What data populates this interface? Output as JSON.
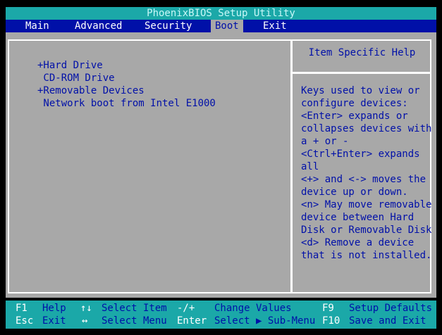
{
  "window": {
    "title": "PhoenixBIOS Setup Utility"
  },
  "menu": {
    "items": [
      {
        "label": "Main"
      },
      {
        "label": "Advanced"
      },
      {
        "label": "Security"
      },
      {
        "label": "Boot"
      },
      {
        "label": "Exit"
      }
    ],
    "active": "Boot"
  },
  "boot_order": {
    "items": [
      {
        "label": "+Hard Drive"
      },
      {
        "label": " CD-ROM Drive"
      },
      {
        "label": "+Removable Devices"
      },
      {
        "label": " Network boot from Intel E1000"
      }
    ]
  },
  "help": {
    "title": "Item Specific Help",
    "lines": [
      "Keys used to view or",
      "configure devices:",
      "<Enter> expands or",
      "collapses devices with",
      "a + or -",
      "<Ctrl+Enter> expands",
      "all",
      "<+> and <-> moves the",
      "device up or down.",
      "<n> May move removable",
      "device between Hard",
      "Disk or Removable Disk",
      "<d> Remove a device",
      "that is not installed."
    ]
  },
  "footer": {
    "row1": [
      {
        "key": "F1",
        "desc": "Help"
      },
      {
        "key": "↑↓",
        "desc": "Select Item"
      },
      {
        "key": "-/+",
        "desc": "Change Values"
      },
      {
        "key": "F9",
        "desc": "Setup Defaults"
      }
    ],
    "row2": [
      {
        "key": "Esc",
        "desc": "Exit"
      },
      {
        "key": "↔",
        "desc": "Select Menu"
      },
      {
        "key": "Enter",
        "desc": "Select ▶ Sub-Menu"
      },
      {
        "key": "F10",
        "desc": "Save and Exit"
      }
    ]
  },
  "colors": {
    "title_bg": "#1ba8a8",
    "menu_bg": "#0010a8",
    "panel_bg": "#a8a8a8",
    "text_blue": "#0010a8"
  }
}
